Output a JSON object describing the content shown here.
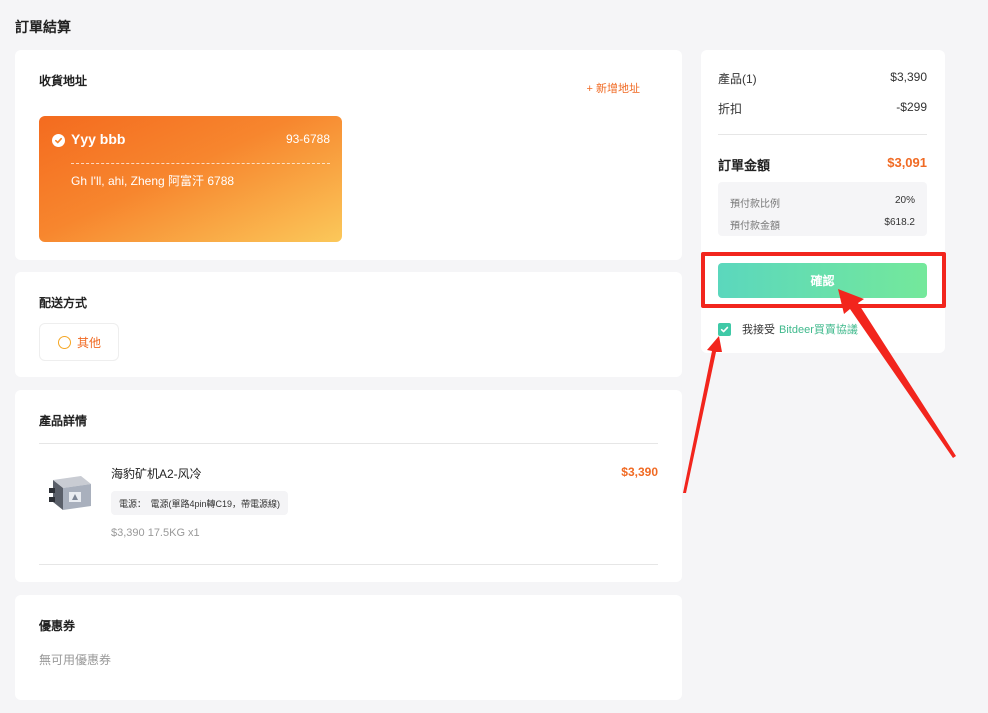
{
  "page": {
    "title": "訂單結算"
  },
  "address": {
    "section_title": "收貨地址",
    "add_label": "+ 新增地址",
    "selected": {
      "name": "Yyy bbb",
      "phone": "93-6788",
      "line": "Gh I'll, ahi, Zheng 阿富汗 6788"
    }
  },
  "shipping": {
    "section_title": "配送方式",
    "option_label": "其他"
  },
  "product": {
    "section_title": "產品詳情",
    "item": {
      "name": "海豹矿机A2-风冷",
      "price": "$3,390",
      "tag": "電源：　電源(單路4pin轉C19，帶電源線)",
      "meta": "$3,390  17.5KG x1"
    }
  },
  "coupon": {
    "section_title": "優惠券",
    "empty_text": "無可用優惠券"
  },
  "summary": {
    "products_label": "產品(1)",
    "products_value": "$3,390",
    "discount_label": "折扣",
    "discount_value": "-$299",
    "total_label": "訂單金額",
    "total_value": "$3,091",
    "prepay_ratio_label": "預付款比例",
    "prepay_ratio_value": "20%",
    "prepay_amount_label": "預付款金額",
    "prepay_amount_value": "$618.2",
    "confirm_label": "確認",
    "agree_text": "我接受",
    "agree_link": "Bitdeer買賣協議"
  },
  "colors": {
    "accent": "#f06a23",
    "confirm_gradient": [
      "#5bd7bd",
      "#74e89b"
    ],
    "annotation": "#f2251d"
  }
}
